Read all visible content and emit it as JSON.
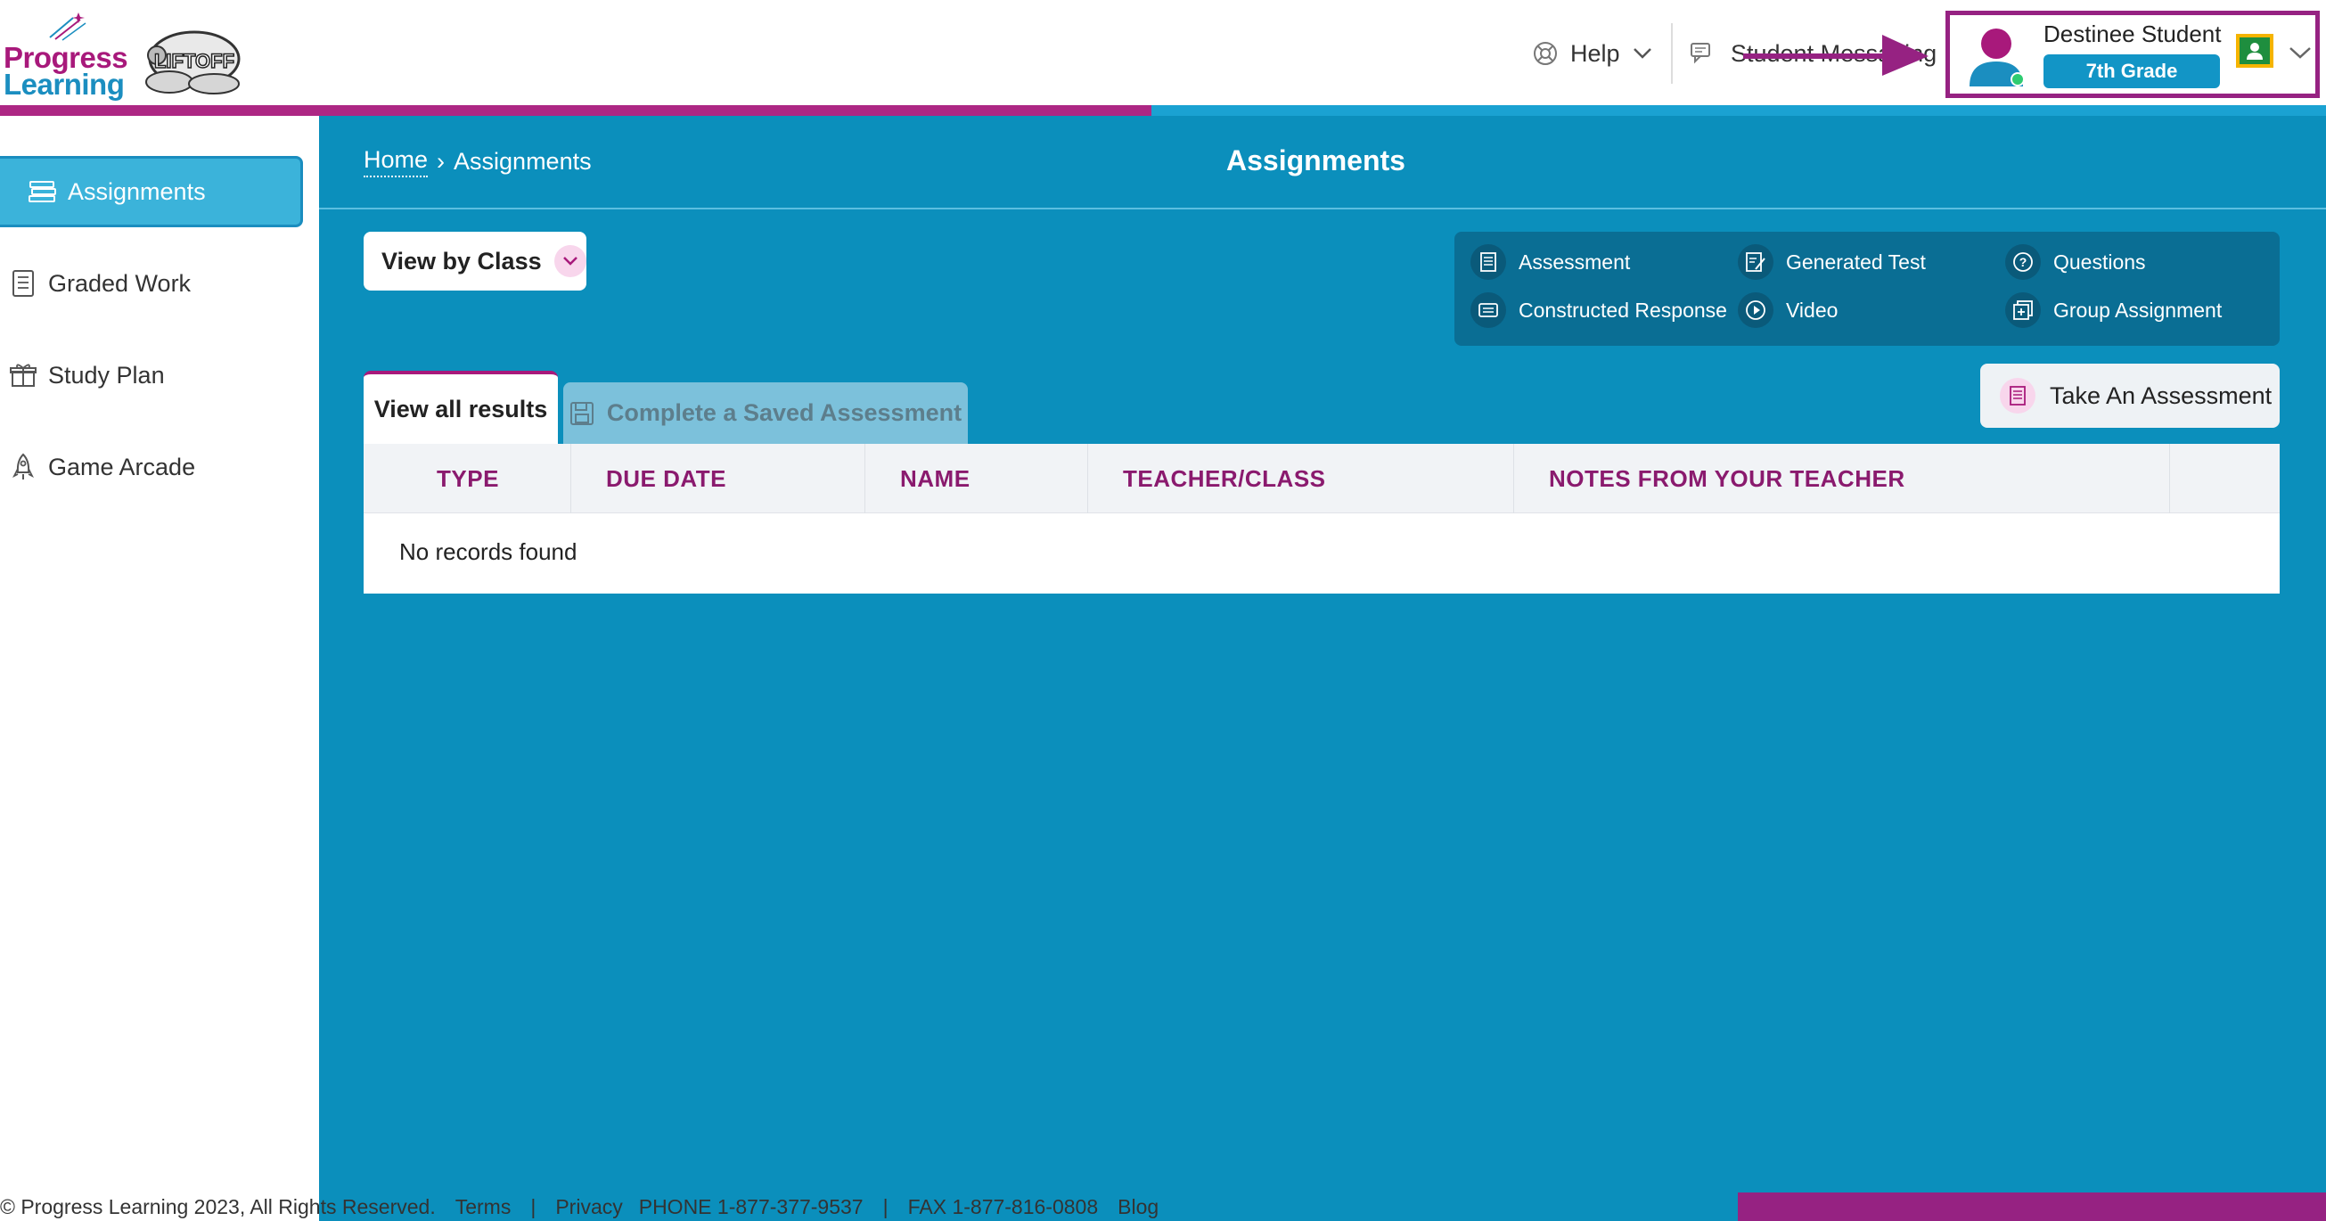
{
  "brand": {
    "logo_line1": "Progress",
    "logo_line2": "Learning",
    "liftoff_logo": "LIFTOFF"
  },
  "header": {
    "help_label": "Help",
    "messaging_label": "Student Messaging",
    "user": {
      "name": "Destinee Student",
      "grade": "7th Grade"
    },
    "progress_fraction": 0.495
  },
  "sidebar": {
    "items": [
      {
        "label": "Assignments",
        "icon": "books-icon",
        "active": true
      },
      {
        "label": "Graded Work",
        "icon": "checklist-icon",
        "active": false
      },
      {
        "label": "Study Plan",
        "icon": "gift-icon",
        "active": false
      },
      {
        "label": "Game Arcade",
        "icon": "rocket-icon",
        "active": false
      }
    ]
  },
  "main": {
    "breadcrumb": {
      "home": "Home",
      "separator": "›",
      "current": "Assignments"
    },
    "title": "Assignments",
    "view_by_class": "View by Class",
    "legend": [
      {
        "label": "Assessment",
        "icon": "assessment-icon"
      },
      {
        "label": "Generated Test",
        "icon": "generated-test-icon"
      },
      {
        "label": "Questions",
        "icon": "question-icon"
      },
      {
        "label": "Constructed Response",
        "icon": "constructed-response-icon"
      },
      {
        "label": "Video",
        "icon": "video-icon"
      },
      {
        "label": "Group Assignment",
        "icon": "group-assignment-icon"
      }
    ],
    "tabs": {
      "active": "View all results",
      "inactive": "Complete a Saved Assessment"
    },
    "take_assessment": "Take An Assessment",
    "table": {
      "columns": [
        "TYPE",
        "DUE DATE",
        "NAME",
        "TEACHER/CLASS",
        "NOTES FROM YOUR TEACHER"
      ],
      "empty_message": "No records found"
    }
  },
  "footer": {
    "copyright": "© Progress Learning 2023, All Rights Reserved.",
    "terms": "Terms",
    "sep1": "|",
    "privacy": "Privacy",
    "phone": "PHONE 1-877-377-9537",
    "sep2": "|",
    "fax": "FAX 1-877-816-0808",
    "blog": "Blog"
  },
  "colors": {
    "primary_blue": "#0b8fbc",
    "brand_magenta": "#962282",
    "header_text_magenta": "#8a1a6e"
  }
}
